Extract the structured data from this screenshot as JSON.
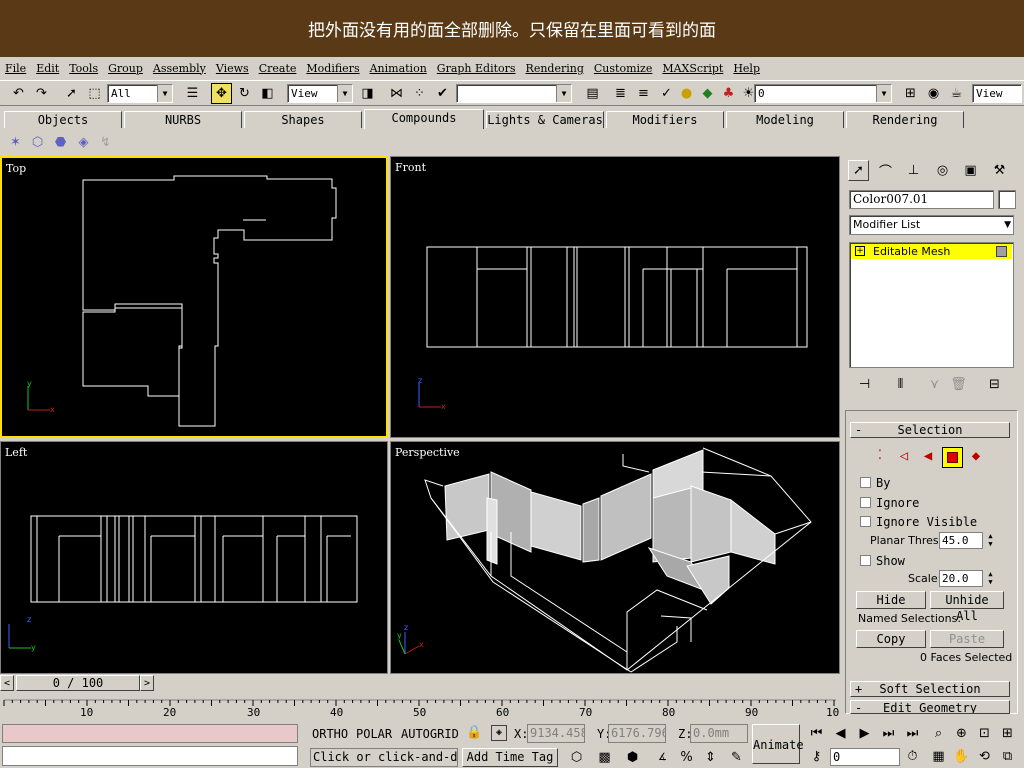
{
  "banner": {
    "text": "把外面没有用的面全部删除。只保留在里面可看到的面"
  },
  "menu": [
    "File",
    "Edit",
    "Tools",
    "Group",
    "Assembly",
    "Views",
    "Create",
    "Modifiers",
    "Animation",
    "Graph Editors",
    "Rendering",
    "Customize",
    "MAXScript",
    "Help"
  ],
  "toolbar": {
    "selection_filter": "All",
    "ref_coord": "View",
    "named_selection": "",
    "layer": "0",
    "render_view": "View"
  },
  "tabs": [
    "Objects",
    "NURBS",
    "Shapes",
    "Compounds",
    "Lights & Cameras",
    "Modifiers",
    "Modeling",
    "Rendering"
  ],
  "active_tab": "Compounds",
  "viewports": {
    "top": "Top",
    "front": "Front",
    "left": "Left",
    "perspective": "Perspective"
  },
  "axes": {
    "x": "x",
    "y": "y",
    "z": "z"
  },
  "command_panel": {
    "object_name": "Color007.01",
    "modifier_list": "Modifier List",
    "stack_item": "Editable Mesh",
    "stack_plus": "+",
    "rollout_minus": "-",
    "selection_rollout": "Selection",
    "by": "By",
    "ignore": "Ignore",
    "ignore_visible": "Ignore Visible",
    "planar_thresh_label": "Planar Thresh:",
    "planar_thresh": "45.0",
    "show": "Show",
    "scale_label": "Scale:",
    "scale": "20.0",
    "hide": "Hide",
    "unhide_all": "Unhide All",
    "named_selections": "Named Selections:",
    "copy": "Copy",
    "paste": "Paste",
    "faces_selected": "0 Faces Selected",
    "soft_selection": "Soft Selection",
    "edit_geometry": "Edit Geometry"
  },
  "timeline": {
    "frame": "0 / 100",
    "ticks": [
      "10",
      "20",
      "30",
      "40",
      "50",
      "60",
      "70",
      "80",
      "90",
      "10"
    ]
  },
  "status": {
    "prompt": "Click or click-and-d",
    "add_time_tag": "Add Time Tag",
    "ortho": "ORTHO",
    "polar": "POLAR",
    "autogrid": "AUTOGRID",
    "x_label": "X:",
    "x_value": "9134.458",
    "y_label": "Y:",
    "y_value": "6176.796",
    "z_label": "Z:",
    "z_value": "0.0mm",
    "animate": "Animate",
    "current_frame": "0"
  }
}
